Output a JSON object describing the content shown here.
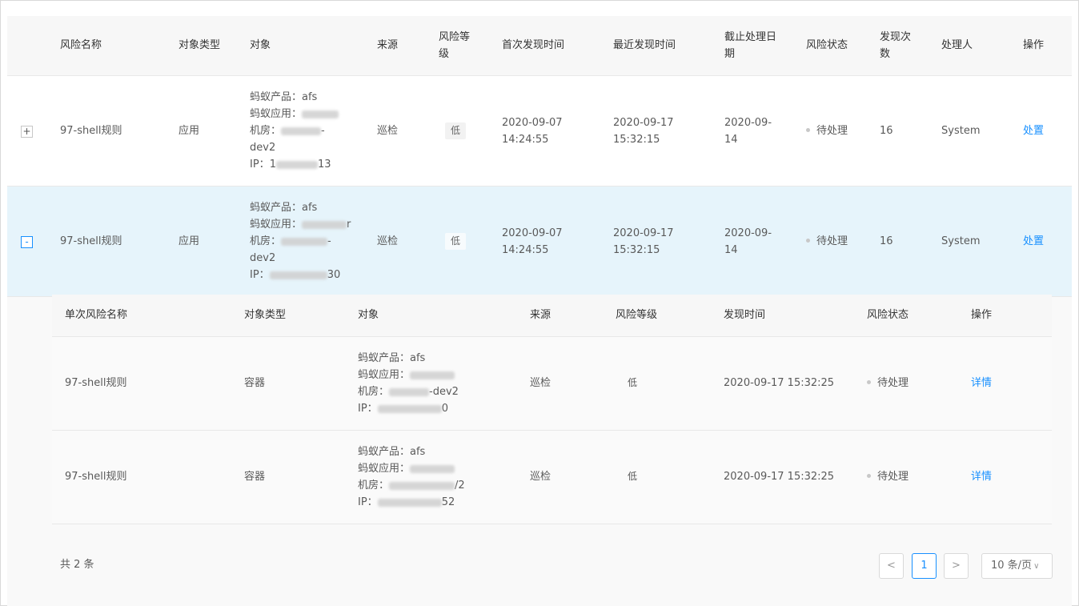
{
  "columns": {
    "risk_name": "风险名称",
    "object_type": "对象类型",
    "object": "对象",
    "source": "来源",
    "risk_level_1": "风险等",
    "risk_level_2": "级",
    "first_found": "首次发现时间",
    "last_found": "最近发现时间",
    "deadline_1": "截止处理日",
    "deadline_2": "期",
    "risk_status": "风险状态",
    "found_count_1": "发现次",
    "found_count_2": "数",
    "handler": "处理人",
    "action": "操作"
  },
  "rows": [
    {
      "expand_icon": "+",
      "risk_name": "97-shell规则",
      "object_type": "应用",
      "object": {
        "product_label": "蚂蚁产品：",
        "product_value": "afs",
        "app_label": "蚂蚁应用：",
        "app_suffix": "",
        "room_label": "机房：",
        "room_suffix": "-",
        "room_line2": "dev2",
        "ip_label": "IP：",
        "ip_prefix": "1",
        "ip_suffix": "13"
      },
      "source": "巡检",
      "risk_level": "低",
      "first_found_date": "2020-09-07",
      "first_found_time": "14:24:55",
      "last_found_date": "2020-09-17",
      "last_found_time": "15:32:15",
      "deadline_1": "2020-09-",
      "deadline_2": "14",
      "status": "待处理",
      "count": "16",
      "handler": "System",
      "action": "处置"
    },
    {
      "expand_icon": "-",
      "risk_name": "97-shell规则",
      "object_type": "应用",
      "object": {
        "product_label": "蚂蚁产品：",
        "product_value": "afs",
        "app_label": "蚂蚁应用：",
        "app_suffix": "r",
        "room_label": "机房：",
        "room_suffix": "-",
        "room_line2": "dev2",
        "ip_label": "IP：",
        "ip_prefix": "",
        "ip_suffix": "30"
      },
      "source": "巡检",
      "risk_level": "低",
      "first_found_date": "2020-09-07",
      "first_found_time": "14:24:55",
      "last_found_date": "2020-09-17",
      "last_found_time": "15:32:15",
      "deadline_1": "2020-09-",
      "deadline_2": "14",
      "status": "待处理",
      "count": "16",
      "handler": "System",
      "action": "处置"
    }
  ],
  "sub_table": {
    "columns": {
      "single_risk_name": "单次风险名称",
      "object_type": "对象类型",
      "object": "对象",
      "source": "来源",
      "risk_level": "风险等级",
      "found_time": "发现时间",
      "risk_status": "风险状态",
      "action": "操作"
    },
    "rows": [
      {
        "name": "97-shell规则",
        "object_type": "容器",
        "product_label": "蚂蚁产品：",
        "product_value": "afs",
        "app_label": "蚂蚁应用：",
        "room_label": "机房：",
        "room_suffix": "-dev2",
        "ip_label": "IP：",
        "ip_suffix": "0",
        "source": "巡检",
        "risk_level": "低",
        "found_time": "2020-09-17 15:32:25",
        "status": "待处理",
        "action": "详情"
      },
      {
        "name": "97-shell规则",
        "object_type": "容器",
        "product_label": "蚂蚁产品：",
        "product_value": "afs",
        "app_label": "蚂蚁应用：",
        "room_label": "机房：",
        "room_suffix": "/2",
        "ip_label": "IP：",
        "ip_suffix": "52",
        "source": "巡检",
        "risk_level": "低",
        "found_time": "2020-09-17 15:32:25",
        "status": "待处理",
        "action": "详情"
      }
    ],
    "total": "共 2 条",
    "pagination": {
      "prev": "<",
      "current_page": "1",
      "next": ">",
      "page_size": "10 条/页"
    }
  },
  "colors": {
    "link": "#1890ff",
    "selected_row": "#e6f4fb",
    "header_bg": "#f7f7f7"
  }
}
